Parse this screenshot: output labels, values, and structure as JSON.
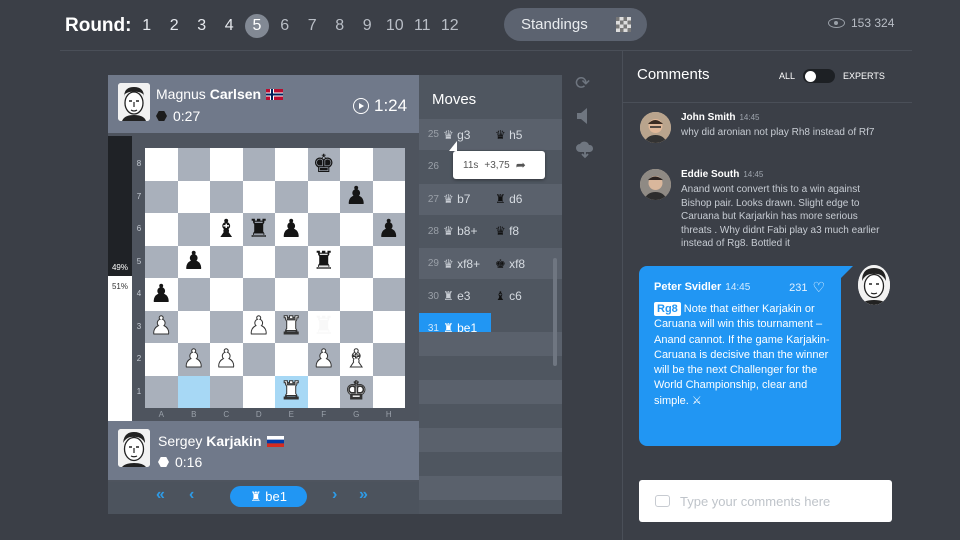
{
  "header": {
    "round_label": "Round:",
    "rounds": [
      "1",
      "2",
      "3",
      "4",
      "5",
      "6",
      "7",
      "8",
      "9",
      "10",
      "11",
      "12"
    ],
    "active_round": "5",
    "standings_label": "Standings",
    "viewers": "153 324"
  },
  "top_player": {
    "first_name": "Magnus",
    "last_name": "Carlsen",
    "flag": "Norway",
    "increment": "0:27",
    "clock": "1:24"
  },
  "bottom_player": {
    "first_name": "Sergey",
    "last_name": "Karjakin",
    "flag": "Russia",
    "increment": "0:16"
  },
  "eval": {
    "black_pct_label": "49%",
    "white_pct_label": "51%",
    "black_fraction": 0.49
  },
  "board": {
    "ranks": [
      "8",
      "7",
      "6",
      "5",
      "4",
      "3",
      "2",
      "1"
    ],
    "files": [
      "A",
      "B",
      "C",
      "D",
      "E",
      "F",
      "G",
      "H"
    ],
    "position": [
      [
        "",
        "",
        "",
        "",
        "",
        "k",
        "",
        ""
      ],
      [
        "",
        "",
        "",
        "",
        "",
        "",
        "p",
        ""
      ],
      [
        "",
        "",
        "b",
        "r",
        "p",
        "",
        "",
        "p"
      ],
      [
        "",
        "p",
        "",
        "",
        "",
        "r",
        "",
        ""
      ],
      [
        "p",
        "",
        "",
        "",
        "",
        "",
        "",
        ""
      ],
      [
        "P",
        "",
        "",
        "P",
        "R",
        "W",
        "",
        ""
      ],
      [
        "",
        "P",
        "P",
        "",
        "",
        "P",
        "B",
        ""
      ],
      [
        "",
        "",
        "",
        "",
        "R",
        "",
        "K",
        ""
      ]
    ],
    "highlight": [
      "b1",
      "e1"
    ]
  },
  "moves": {
    "title": "Moves",
    "rows": [
      {
        "n": "25",
        "w": "g3",
        "wp": "queen",
        "b": "h5",
        "bp": "queen"
      },
      {
        "n": "26",
        "w": "",
        "wp": "",
        "b": "",
        "bp": ""
      },
      {
        "n": "27",
        "w": "b7",
        "wp": "queen",
        "b": "d6",
        "bp": "rook"
      },
      {
        "n": "28",
        "w": "b8+",
        "wp": "queen",
        "b": "f8",
        "bp": "queen"
      },
      {
        "n": "29",
        "w": "xf8+",
        "wp": "queen",
        "b": "xf8",
        "bp": "king"
      },
      {
        "n": "30",
        "w": "e3",
        "wp": "rook",
        "b": "c6",
        "bp": "bishop"
      },
      {
        "n": "31",
        "w": "be1",
        "wp": "rook",
        "b": "",
        "bp": ""
      }
    ],
    "tooltip_time": "11s",
    "tooltip_eval": "+3,75",
    "current_move": "be1"
  },
  "comments": {
    "title": "Comments",
    "toggle_all": "ALL",
    "toggle_experts": "EXPERTS",
    "items": [
      {
        "name": "John Smith",
        "time": "14:45",
        "text": "why did aronian not play Rh8 instead of Rf7"
      },
      {
        "name": "Eddie South",
        "time": "14:45",
        "text": "Anand wont convert this to a win against Bishop pair. Looks drawn. Slight edge to Caruana but Karjarkin has more serious threats . Why didnt Fabi play a3 much earlier instead of Rg8. Bottled it"
      }
    ],
    "expert": {
      "name": "Peter Svidler",
      "time": "14:45",
      "likes": "231",
      "tag": "Rg8",
      "text": "Note that either Karjakin or Caruana will win this tournament – Anand cannot. If the game Karjakin-Caruana is decisive than the winner will be the next Challenger for the World Championship, clear and simple."
    },
    "placeholder": "Type your comments here"
  }
}
